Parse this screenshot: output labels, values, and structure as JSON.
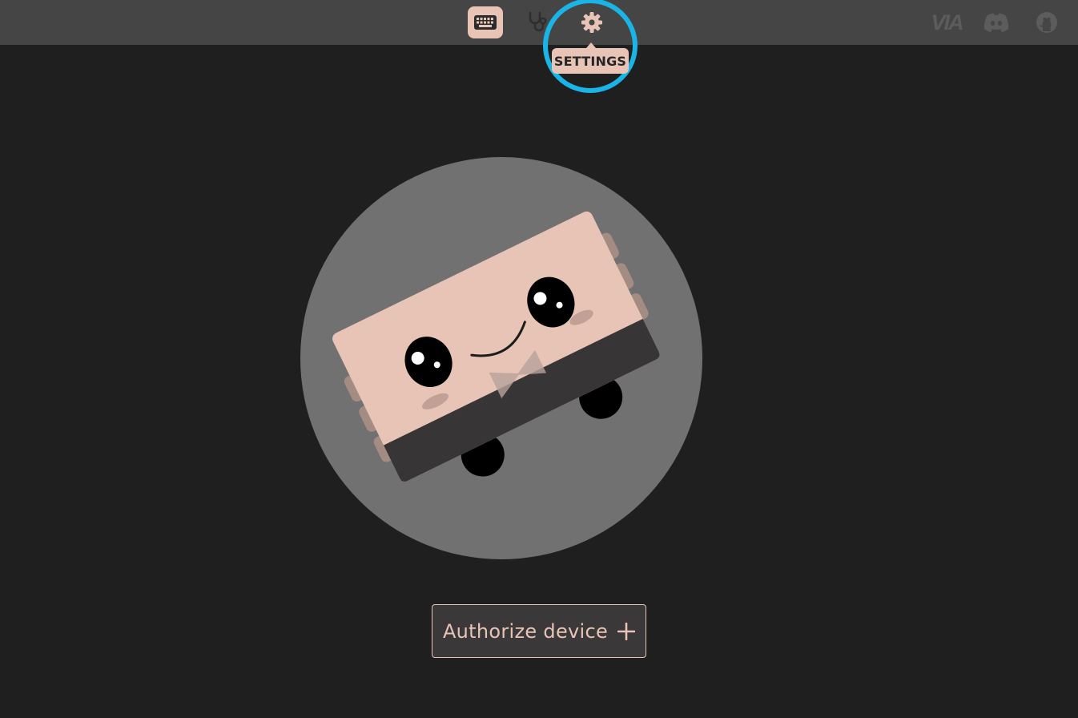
{
  "nav": {
    "items": [
      {
        "name": "configure",
        "icon": "keyboard-icon",
        "active": true
      },
      {
        "name": "debug",
        "icon": "stethoscope-icon",
        "active": false
      },
      {
        "name": "settings",
        "icon": "gear-icon",
        "active": false
      }
    ],
    "tooltip": "SETTINGS",
    "external": {
      "via_label": "VIA",
      "discord_icon": "discord-icon",
      "github_icon": "github-icon"
    }
  },
  "main": {
    "authorize_label": "Authorize device",
    "authorize_icon": "plus-icon"
  },
  "colors": {
    "accent": "#e8c4b6",
    "topbar": "#454545",
    "background": "#1f1f20",
    "highlight": "#1ab4e6",
    "icon_inactive": "#5c5c5c"
  }
}
